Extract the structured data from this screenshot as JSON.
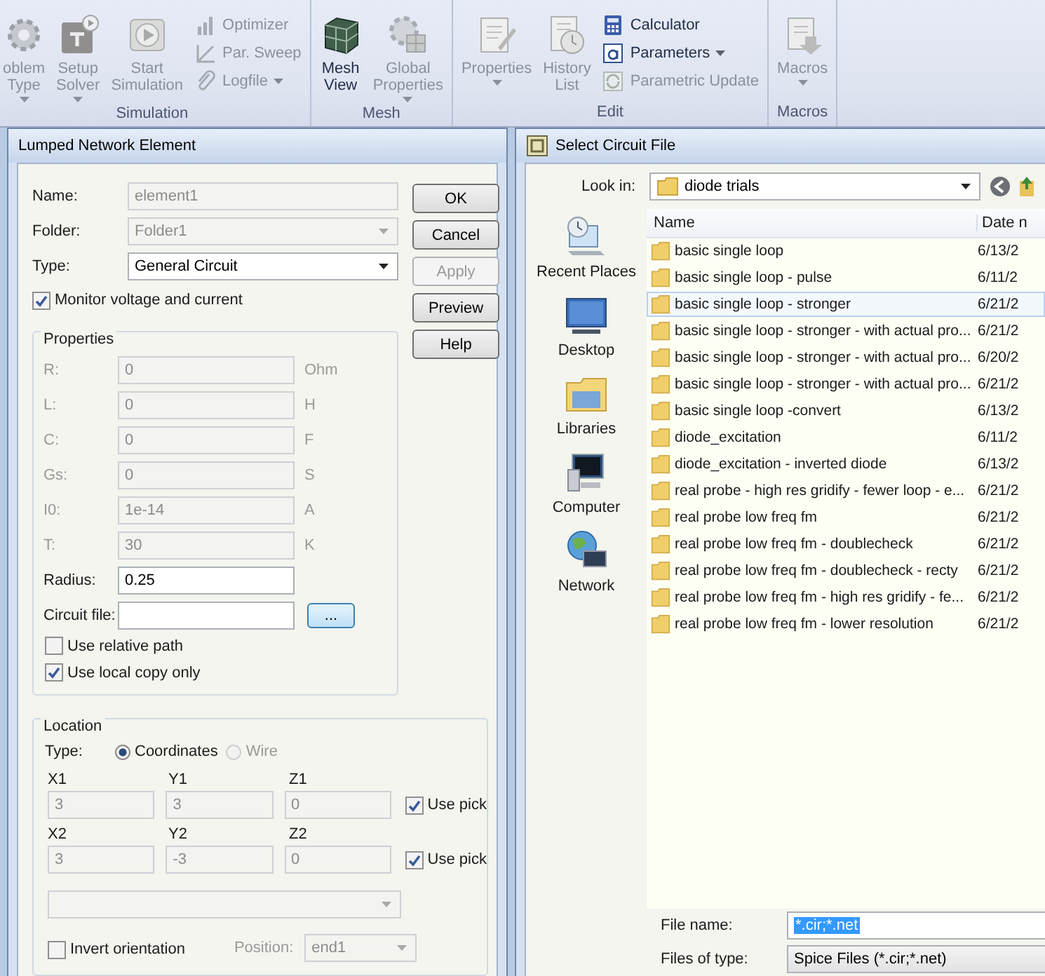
{
  "ribbon": {
    "groups": [
      {
        "label": "Simulation",
        "items": [
          {
            "kind": "large",
            "lines": [
              "oblem",
              "Type"
            ],
            "dropdown": true,
            "disabled": true
          },
          {
            "kind": "large",
            "lines": [
              "Setup",
              "Solver"
            ],
            "dropdown": true,
            "disabled": true
          },
          {
            "kind": "large",
            "lines": [
              "Start",
              "Simulation"
            ],
            "dropdown": false,
            "disabled": true
          },
          {
            "kind": "stack",
            "items": [
              {
                "label": "Optimizer",
                "dropdown": false,
                "disabled": true
              },
              {
                "label": "Par. Sweep",
                "dropdown": false,
                "disabled": true
              },
              {
                "label": "Logfile",
                "dropdown": true,
                "disabled": true
              }
            ]
          }
        ]
      },
      {
        "label": "Mesh",
        "items": [
          {
            "kind": "large",
            "lines": [
              "Mesh",
              "View"
            ],
            "dropdown": false,
            "disabled": false
          },
          {
            "kind": "large",
            "lines": [
              "Global",
              "Properties"
            ],
            "dropdown": true,
            "disabled": true
          }
        ]
      },
      {
        "label": "Edit",
        "items": [
          {
            "kind": "large",
            "lines": [
              "Properties"
            ],
            "dropdown": true,
            "disabled": true
          },
          {
            "kind": "large",
            "lines": [
              "History",
              "List"
            ],
            "dropdown": false,
            "disabled": true
          },
          {
            "kind": "stack",
            "items": [
              {
                "label": "Calculator",
                "dropdown": false,
                "disabled": false
              },
              {
                "label": "Parameters",
                "dropdown": true,
                "disabled": false
              },
              {
                "label": "Parametric Update",
                "dropdown": false,
                "disabled": true
              }
            ]
          }
        ]
      },
      {
        "label": "Macros",
        "items": [
          {
            "kind": "large",
            "lines": [
              "Macros"
            ],
            "dropdown": true,
            "disabled": true
          }
        ]
      }
    ]
  },
  "lumped_dialog": {
    "title": "Lumped Network Element",
    "fields": [
      {
        "label": "Name:",
        "value": "element1",
        "kind": "text",
        "disabled": true
      },
      {
        "label": "Folder:",
        "value": "Folder1",
        "kind": "select",
        "disabled": true
      },
      {
        "label": "Type:",
        "value": "General Circuit",
        "kind": "select",
        "disabled": false
      }
    ],
    "buttons": [
      {
        "label": "OK",
        "disabled": false
      },
      {
        "label": "Cancel",
        "disabled": false
      },
      {
        "label": "Apply",
        "disabled": true
      },
      {
        "label": "Preview",
        "disabled": false
      },
      {
        "label": "Help",
        "disabled": false
      }
    ],
    "monitor": {
      "label": "Monitor voltage and current",
      "checked": true
    },
    "properties": {
      "title": "Properties",
      "rows": [
        {
          "label": "R:",
          "value": "0",
          "unit": "Ohm",
          "disabled": true
        },
        {
          "label": "L:",
          "value": "0",
          "unit": "H",
          "disabled": true
        },
        {
          "label": "C:",
          "value": "0",
          "unit": "F",
          "disabled": true
        },
        {
          "label": "Gs:",
          "value": "0",
          "unit": "S",
          "disabled": true
        },
        {
          "label": "I0:",
          "value": "1e-14",
          "unit": "A",
          "disabled": true
        },
        {
          "label": "T:",
          "value": "30",
          "unit": "K",
          "disabled": true
        },
        {
          "label": "Radius:",
          "value": "0.25",
          "unit": "",
          "disabled": false
        }
      ],
      "circuit_file": {
        "label": "Circuit file:",
        "browse": "..."
      },
      "options": [
        {
          "label": "Use relative path",
          "checked": false
        },
        {
          "label": "Use local copy only",
          "checked": true
        }
      ]
    },
    "location": {
      "title": "Location",
      "type_label": "Type:",
      "radios": [
        {
          "label": "Coordinates",
          "selected": true,
          "disabled": false
        },
        {
          "label": "Wire",
          "selected": false,
          "disabled": true
        }
      ],
      "points": [
        {
          "coords": [
            {
              "label": "X1",
              "value": "3"
            },
            {
              "label": "Y1",
              "value": "3"
            },
            {
              "label": "Z1",
              "value": "0"
            }
          ],
          "pick": {
            "label": "Use pick",
            "checked": true
          }
        },
        {
          "coords": [
            {
              "label": "X2",
              "value": "3"
            },
            {
              "label": "Y2",
              "value": "-3"
            },
            {
              "label": "Z2",
              "value": "0"
            }
          ],
          "pick": {
            "label": "Use pick",
            "checked": true
          }
        }
      ],
      "invert": {
        "label": "Invert orientation",
        "checked": false
      },
      "position": {
        "label": "Position:",
        "value": "end1"
      }
    }
  },
  "file_dialog": {
    "title": "Select Circuit File",
    "look_in": {
      "label": "Look in:",
      "value": "diode trials"
    },
    "places": [
      "Recent Places",
      "Desktop",
      "Libraries",
      "Computer",
      "Network"
    ],
    "columns": [
      "Name",
      "Date n"
    ],
    "rows": [
      {
        "name": "basic single loop",
        "date": "6/13/2",
        "selected": false
      },
      {
        "name": "basic single loop - pulse",
        "date": "6/11/2",
        "selected": false
      },
      {
        "name": "basic single loop - stronger",
        "date": "6/21/2",
        "selected": true
      },
      {
        "name": "basic single loop - stronger - with actual pro...",
        "date": "6/21/2",
        "selected": false
      },
      {
        "name": "basic single loop - stronger - with actual pro...",
        "date": "6/20/2",
        "selected": false
      },
      {
        "name": "basic single loop - stronger - with actual pro...",
        "date": "6/21/2",
        "selected": false
      },
      {
        "name": "basic single loop -convert",
        "date": "6/13/2",
        "selected": false
      },
      {
        "name": "diode_excitation",
        "date": "6/11/2",
        "selected": false
      },
      {
        "name": "diode_excitation - inverted diode",
        "date": "6/13/2",
        "selected": false
      },
      {
        "name": "real probe - high res gridify - fewer loop - e...",
        "date": "6/21/2",
        "selected": false
      },
      {
        "name": "real probe low freq fm",
        "date": "6/21/2",
        "selected": false
      },
      {
        "name": "real probe low freq fm - doublecheck",
        "date": "6/21/2",
        "selected": false
      },
      {
        "name": "real probe low freq fm - doublecheck - recty",
        "date": "6/21/2",
        "selected": false
      },
      {
        "name": "real probe low freq fm - high res gridify - fe...",
        "date": "6/21/2",
        "selected": false
      },
      {
        "name": "real probe low freq fm - lower resolution",
        "date": "6/21/2",
        "selected": false
      }
    ],
    "file_name": {
      "label": "File name:",
      "value": "*.cir;*.net"
    },
    "file_type": {
      "label": "Files of type:",
      "value": "Spice Files (*.cir;*.net)"
    }
  }
}
